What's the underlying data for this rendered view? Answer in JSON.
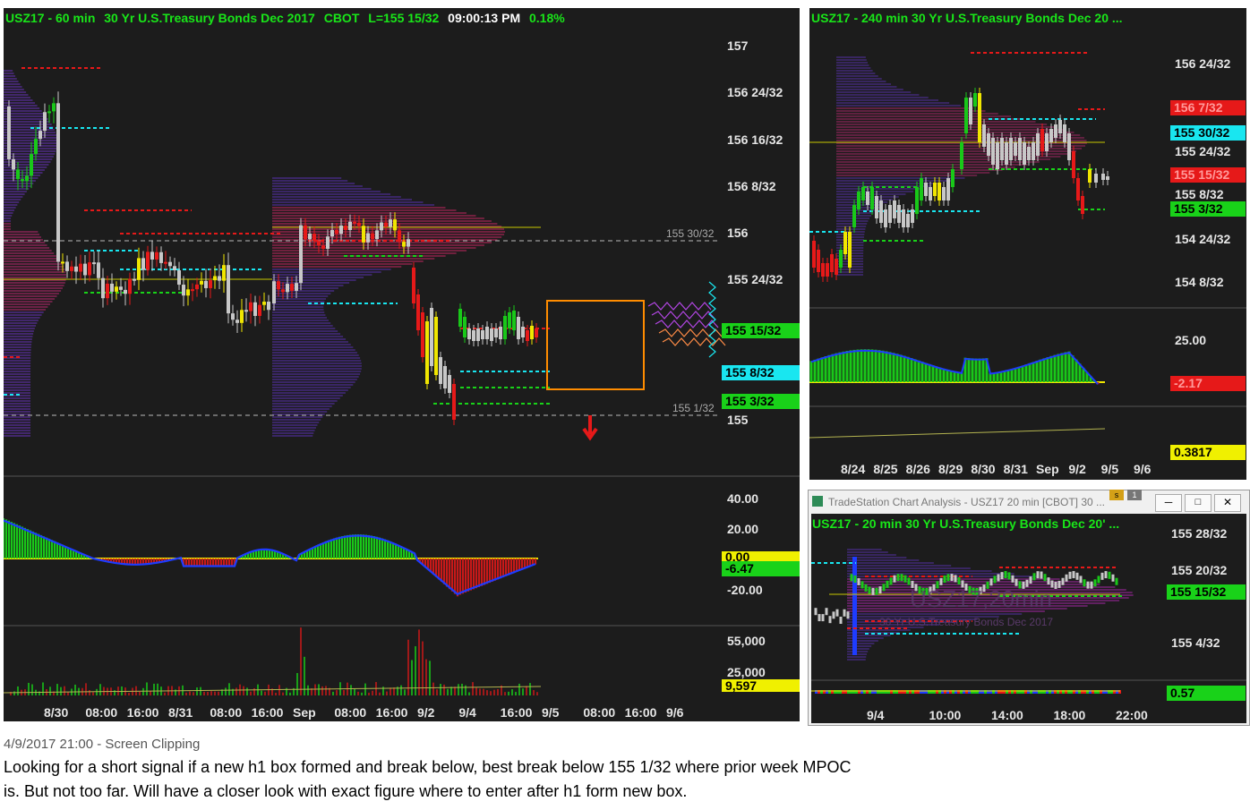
{
  "main": {
    "header": {
      "symbol": "USZ17 - 60 min",
      "name": "30 Yr U.S.Treasury Bonds Dec 2017",
      "exch": "CBOT",
      "last": "L=155 15/32",
      "time": "09:00:13 PM",
      "pct": "0.18%"
    },
    "price_axis": [
      "157",
      "156 24/32",
      "156 16/32",
      "156 8/32",
      "156",
      "155 24/32",
      "155"
    ],
    "tags": [
      {
        "text": "155 15/32",
        "bg": "#19d219",
        "fg": "#000"
      },
      {
        "text": "155 8/32",
        "bg": "#19e6f0",
        "fg": "#000"
      },
      {
        "text": "155 3/32",
        "bg": "#19d219",
        "fg": "#000"
      }
    ],
    "level_labels": [
      "155 30/32",
      "155 1/32"
    ],
    "osc_axis": [
      "40.00",
      "20.00",
      "-20.00"
    ],
    "osc_tags": [
      {
        "text": "0.00",
        "bg": "#f0f000",
        "fg": "#000"
      },
      {
        "text": "-6.47",
        "bg": "#19d219",
        "fg": "#000"
      }
    ],
    "vol_axis": [
      "55,000",
      "25,000"
    ],
    "vol_tag": {
      "text": "9,597",
      "bg": "#f0f000",
      "fg": "#000"
    },
    "xaxis": [
      "8/30",
      "08:00",
      "16:00",
      "8/31",
      "08:00",
      "16:00",
      "Sep",
      "08:00",
      "16:00",
      "9/2",
      "9/4",
      "16:00",
      "9/5",
      "08:00",
      "16:00",
      "9/6"
    ]
  },
  "h4": {
    "header": "USZ17 - 240 min  30 Yr U.S.Treasury Bonds Dec 20 ...",
    "price_axis": [
      "156 24/32",
      "155 24/32",
      "155 8/32",
      "154 24/32",
      "154 8/32"
    ],
    "tags": [
      {
        "text": "156 7/32",
        "bg": "#e61919",
        "fg": "#ff9a9a"
      },
      {
        "text": "155 30/32",
        "bg": "#19e6f0",
        "fg": "#000"
      },
      {
        "text": "155 15/32",
        "bg": "#e61919",
        "fg": "#ff9a9a"
      },
      {
        "text": "155 3/32",
        "bg": "#19d219",
        "fg": "#000"
      }
    ],
    "osc_axis": [
      "25.00"
    ],
    "osc_tags": [
      {
        "text": "-2.17",
        "bg": "#e61919",
        "fg": "#ff9a9a"
      }
    ],
    "vol_tag": {
      "text": "0.3817",
      "bg": "#f0f000",
      "fg": "#000"
    },
    "xaxis": [
      "8/24",
      "8/25",
      "8/26",
      "8/29",
      "8/30",
      "8/31",
      "Sep",
      "9/2",
      "9/5",
      "9/6"
    ]
  },
  "m20": {
    "window_title": "TradeStation Chart Analysis - USZ17 20 min [CBOT] 30 ...",
    "header": "USZ17 - 20 min  30 Yr U.S.Treasury Bonds Dec 20' ...",
    "watermark_symbol": "USZ17,20min",
    "watermark_name": "30 Yr U.S.Treasury Bonds Dec 2017",
    "price_axis": [
      "155 28/32",
      "155 20/32",
      "155 4/32"
    ],
    "tag": {
      "text": "155 15/32",
      "bg": "#19d219",
      "fg": "#000"
    },
    "vol_tag": {
      "text": "0.57",
      "bg": "#19d219",
      "fg": "#000"
    },
    "xaxis": [
      "9/4",
      "10:00",
      "14:00",
      "18:00",
      "22:00"
    ]
  },
  "footer": {
    "timestamp": "4/9/2017 21:00 - Screen Clipping",
    "line1": "Looking for a short signal if a new h1 box formed and break below, best break below 155 1/32 where prior week MPOC",
    "line2": "is. But not too far. Will have a closer look with exact figure where to enter after h1 form new box."
  },
  "colors": {
    "bg": "#1c1c1c",
    "up": "#19c819",
    "down": "#e61919",
    "neutral": "#c8c8c8",
    "signal": "#f0e600",
    "cyan": "#19e6f0",
    "profile": "#8c28c8",
    "box": "#ff8c00"
  }
}
